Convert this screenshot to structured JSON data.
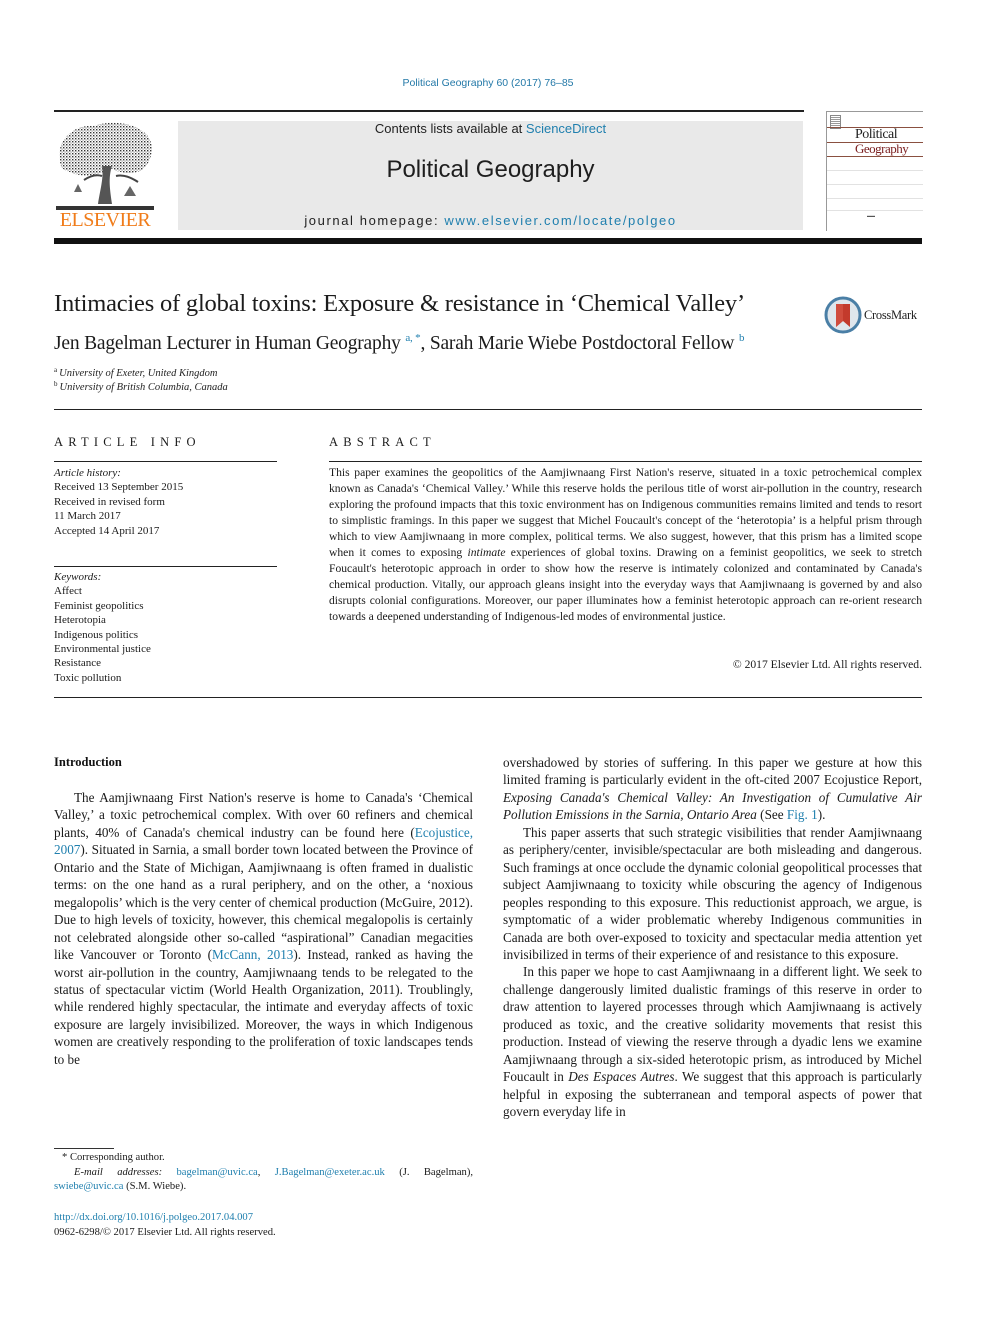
{
  "running_header": "Political Geography 60 (2017) 76–85",
  "masthead": {
    "publisher_logo_text": "ELSEVIER",
    "contents_prefix": "Contents lists available at ",
    "contents_link": "ScienceDirect",
    "journal_title": "Political Geography",
    "homepage_prefix": "journal homepage: ",
    "homepage_link": "www.elsevier.com/locate/polgeo",
    "cover_title_line1": "Political",
    "cover_title_line2": "Geography",
    "accent_color": "#f07c1a",
    "link_color": "#1f7fae"
  },
  "article": {
    "title": "Intimacies of global toxins: Exposure & resistance in ‘Chemical Valley’",
    "crossmark_label": "CrossMark",
    "authors": [
      {
        "name": "Jen Bagelman Lecturer in Human Geography",
        "marks": "a, *"
      },
      {
        "name": "Sarah Marie Wiebe Postdoctoral Fellow",
        "marks": "b"
      }
    ],
    "author_separator": ", ",
    "affiliations": [
      {
        "mark": "a",
        "text": "University of Exeter, United Kingdom"
      },
      {
        "mark": "b",
        "text": "University of British Columbia, Canada"
      }
    ]
  },
  "article_info": {
    "heading": "ARTICLE INFO",
    "history_label": "Article history:",
    "history": [
      "Received 13 September 2015",
      "Received in revised form",
      "11 March 2017",
      "Accepted 14 April 2017"
    ],
    "keywords_label": "Keywords:",
    "keywords": [
      "Affect",
      "Feminist geopolitics",
      "Heterotopia",
      "Indigenous politics",
      "Environmental justice",
      "Resistance",
      "Toxic pollution"
    ]
  },
  "abstract": {
    "heading": "ABSTRACT",
    "text_part1": "This paper examines the geopolitics of the Aamjiwnaang First Nation's reserve, situated in a toxic petrochemical complex known as Canada's ‘Chemical Valley.’ While this reserve holds the perilous title of worst air-pollution in the country, research exploring the profound impacts that this toxic environment has on Indigenous communities remains limited and tends to resort to simplistic framings. In this paper we suggest that Michel Foucault's concept of the ‘heterotopia’ is a helpful prism through which to view Aamjiwnaang in more complex, political terms. We also suggest, however, that this prism has a limited scope when it comes to exposing ",
    "text_italic": "intimate",
    "text_part2": " experiences of global toxins. Drawing on a feminist geopolitics, we seek to stretch Foucault's heterotopic approach in order to show how the reserve is intimately colonized and contaminated by Canada's chemical production. Vitally, our approach gleans insight into the everyday ways that Aamjiwnaang is governed by and also disrupts colonial configurations. Moreover, our paper illuminates how a feminist heterotopic approach can re-orient research towards a deepened understanding of Indigenous-led modes of environmental justice.",
    "copyright": "© 2017 Elsevier Ltd. All rights reserved."
  },
  "body": {
    "section_heading": "Introduction",
    "left_p1": {
      "a": "The Aamjiwnaang First Nation's reserve is home to Canada's ‘Chemical Valley,’ a toxic petrochemical complex. With over 60 refiners and chemical plants, 40% of Canada's chemical industry can be found here (",
      "link1": "Ecojustice, 2007",
      "b": "). Situated in Sarnia, a small border town located between the Province of Ontario and the State of Michigan, Aamjiwnaang is often framed in dualistic terms: on the one hand as a rural periphery, and on the other, a ‘noxious megalopolis’ which is the very center of chemical production (McGuire, 2012). Due to high levels of toxicity, however, this chemical megalopolis is certainly not celebrated alongside other so-called “aspirational” Canadian megacities like Vancouver or Toronto (",
      "link2": "McCann, 2013",
      "c": "). Instead, ranked as having the worst air-pollution in the country, Aamjiwnaang tends to be relegated to the status of spectacular victim (World Health Organization, 2011). Troublingly, while rendered highly spectacular, the intimate and everyday affects of toxic exposure are largely invisibilized. Moreover, the ways in which Indigenous women are creatively responding to the proliferation of toxic landscapes tends to be"
    },
    "right_p1": {
      "a": "overshadowed by stories of suffering. In this paper we gesture at how this limited framing is particularly evident in the oft-cited 2007 Ecojustice Report, ",
      "italic": "Exposing Canada's Chemical Valley: An Investigation of Cumulative Air Pollution Emissions in the Sarnia, Ontario Area",
      "b": " (See ",
      "link": "Fig. 1",
      "c": ")."
    },
    "right_p2": "This paper asserts that such strategic visibilities that render Aamjiwnaang as periphery/center, invisible/spectacular are both misleading and dangerous. Such framings at once occlude the dynamic colonial geopolitical processes that subject Aamjiwnaang to toxicity while obscuring the agency of Indigenous peoples responding to this exposure. This reductionist approach, we argue, is symptomatic of a wider problematic whereby Indigenous communities in Canada are both over-exposed to toxicity and spectacular media attention yet invisibilized in terms of their experience of and resistance to this exposure.",
    "right_p3": {
      "a": "In this paper we hope to cast Aamjiwnaang in a different light. We seek to challenge dangerously limited dualistic framings of this reserve in order to draw attention to layered processes through which Aamjiwnaang is actively produced as toxic, and the creative solidarity movements that resist this production. Instead of viewing the reserve through a dyadic lens we examine Aamjiwnaang through a six-sided heterotopic prism, as introduced by Michel Foucault in ",
      "italic": "Des Espaces Autres",
      "b": ". We suggest that this approach is particularly helpful in exposing the subterranean and temporal aspects of power that govern everyday life in"
    }
  },
  "footnotes": {
    "corresponding": "* Corresponding author.",
    "email_label": "E-mail addresses:",
    "email1": "bagelman@uvic.ca",
    "email_sep": ", ",
    "email2": "J.Bagelman@exeter.ac.uk",
    "email2_owner": " (J. Bagelman),",
    "email3": "swiebe@uvic.ca",
    "email3_owner": " (S.M. Wiebe).",
    "doi": "http://dx.doi.org/10.1016/j.polgeo.2017.04.007",
    "issn_line": "0962-6298/© 2017 Elsevier Ltd. All rights reserved."
  }
}
